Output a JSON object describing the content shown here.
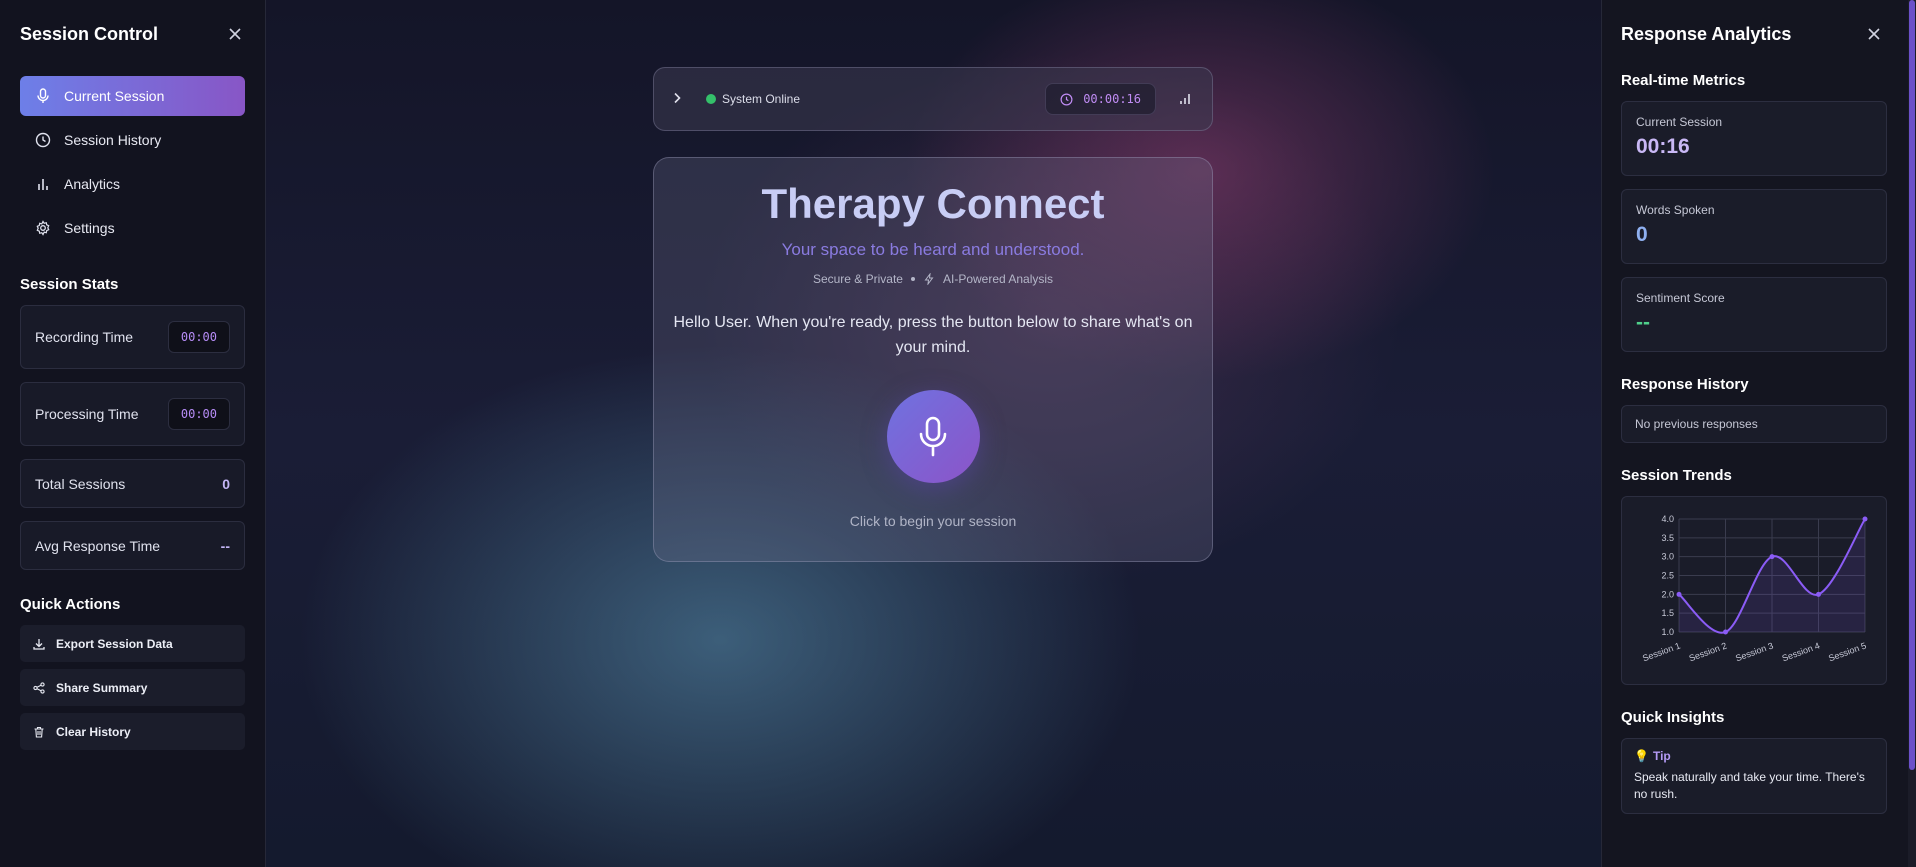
{
  "left": {
    "title": "Session Control",
    "nav": [
      {
        "label": "Current Session",
        "icon": "mic-icon",
        "active": true
      },
      {
        "label": "Session History",
        "icon": "clock-icon"
      },
      {
        "label": "Analytics",
        "icon": "bar-chart-icon"
      },
      {
        "label": "Settings",
        "icon": "gear-icon"
      }
    ],
    "stats_title": "Session Stats",
    "stats": {
      "recording_label": "Recording Time",
      "recording_value": "00:00",
      "processing_label": "Processing Time",
      "processing_value": "00:00",
      "sessions_label": "Total Sessions",
      "sessions_value": "0",
      "avg_label": "Avg Response Time",
      "avg_value": "--"
    },
    "quick_title": "Quick Actions",
    "quick": [
      {
        "label": "Export Session Data",
        "icon": "download-icon"
      },
      {
        "label": "Share Summary",
        "icon": "share-icon"
      },
      {
        "label": "Clear History",
        "icon": "trash-icon"
      }
    ]
  },
  "topbar": {
    "status": "System Online",
    "timer": "00:00:16"
  },
  "main": {
    "title": "Therapy Connect",
    "subtitle": "Your space to be heard and understood.",
    "badge1": "Secure & Private",
    "badge2": "AI-Powered Analysis",
    "greeting": "Hello User. When you're ready, press the button below to share what's on your mind.",
    "hint": "Click to begin your session"
  },
  "right": {
    "title": "Response Analytics",
    "metrics_title": "Real-time Metrics",
    "metrics": [
      {
        "label": "Current Session",
        "value": "00:16",
        "color": "#c9b8f5"
      },
      {
        "label": "Words Spoken",
        "value": "0",
        "color": "#8fb0f0"
      },
      {
        "label": "Sentiment Score",
        "value": "--",
        "color": "#4fd08a"
      }
    ],
    "history_title": "Response History",
    "history_empty": "No previous responses",
    "trends_title": "Session Trends",
    "insights_title": "Quick Insights",
    "tip_label": "Tip",
    "tip_text": "Speak naturally and take your time. There's no rush."
  },
  "chart_data": {
    "type": "line",
    "categories": [
      "Session 1",
      "Session 2",
      "Session 3",
      "Session 4",
      "Session 5"
    ],
    "series": [
      {
        "values": [
          2.0,
          1.0,
          3.0,
          2.0,
          4.0
        ]
      }
    ],
    "ylim": [
      1.0,
      4.0
    ],
    "yticks": [
      "1.0",
      "1.5",
      "2.0",
      "2.5",
      "3.0",
      "3.5",
      "4.0"
    ],
    "grid": true,
    "color": "#8b5cf6"
  }
}
